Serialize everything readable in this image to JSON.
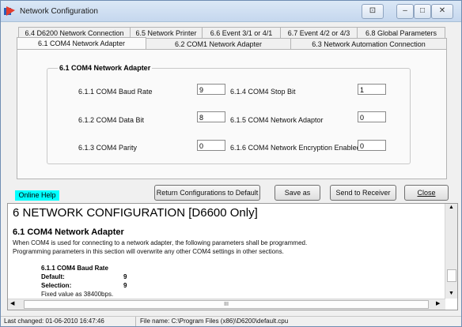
{
  "window": {
    "title": "Network Configuration",
    "buttons": [
      "⊡",
      "–",
      "□",
      "✕"
    ]
  },
  "tabs": {
    "row1": [
      "6.4 D6200 Network Connection",
      "6.5 Network Printer",
      "6.6 Event 3/1 or 4/1",
      "6.7 Event 4/2 or 4/3",
      "6.8 Global Parameters"
    ],
    "row2": [
      "6.1 COM4 Network Adapter",
      "6.2 COM1 Network Adapter",
      "6.3  Network Automation Connection"
    ]
  },
  "group": {
    "title": "6.1 COM4 Network Adapter",
    "fields": [
      {
        "label": "6.1.1 COM4 Baud Rate",
        "value": "9"
      },
      {
        "label": "6.1.2 COM4 Data Bit",
        "value": "8"
      },
      {
        "label": "6.1.3 COM4 Parity",
        "value": "0"
      },
      {
        "label": "6.1.4 COM4 Stop Bit",
        "value": "1"
      },
      {
        "label": "6.1.5 COM4 Network Adaptor",
        "value": "0"
      },
      {
        "label": "6.1.6 COM4 Network Encryption Enabled",
        "value": "0"
      }
    ]
  },
  "actions": {
    "online_help": "Online Help",
    "return_default": "Return Configurations to Default",
    "save_as": "Save as",
    "send_receiver": "Send to Receiver",
    "close": "Close"
  },
  "help": {
    "h1": "6  NETWORK CONFIGURATION [D6600 Only]",
    "h2": "6.1 COM4 Network Adapter",
    "p1": "When COM4 is used for connecting to a network adapter, the following parameters shall be programmed.",
    "p2": "Programming parameters in this section will overwrite any other COM4 settings in other sections.",
    "item_title": "6.1.1 COM4 Baud Rate",
    "default_label": "Default:",
    "default_value": "9",
    "selection_label": "Selection:",
    "selection_value": "9",
    "note": "Fixed value as 38400bps.",
    "scroll_mid": "III"
  },
  "status": {
    "last_changed": "Last changed: 01-06-2010 16:47:46",
    "file_name": "File name: C:\\Program Files (x86)\\D6200\\default.cpu"
  }
}
